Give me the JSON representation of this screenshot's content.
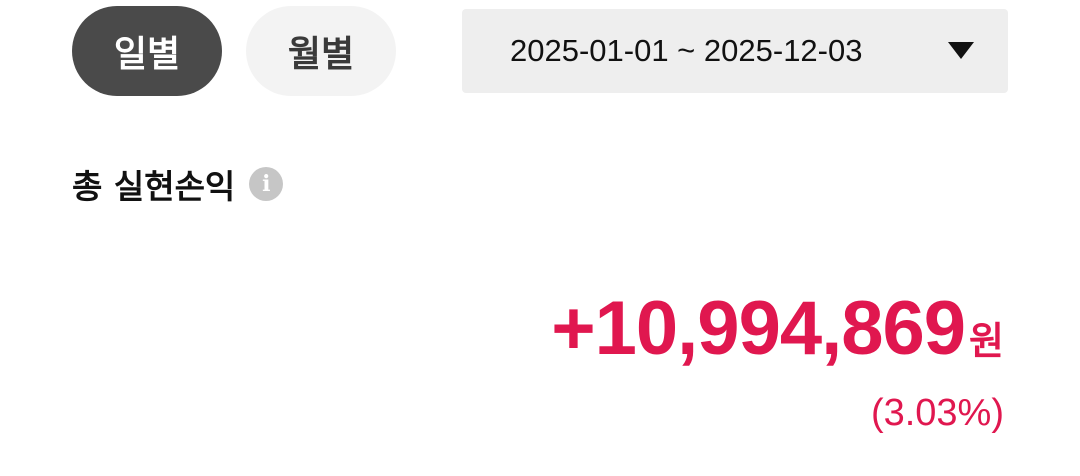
{
  "tabs": {
    "daily": "일별",
    "monthly": "월별"
  },
  "date_range": {
    "value": "2025-01-01 ~ 2025-12-03",
    "dropdown_icon": "caret-down-icon"
  },
  "summary": {
    "title": "총 실현손익",
    "info_icon": "info-icon",
    "info_glyph": "i",
    "amount": "+10,994,869",
    "currency": "원",
    "rate": "(3.03%)"
  },
  "colors": {
    "tab_active_bg": "#4a4a4a",
    "tab_inactive_bg": "#f3f3f3",
    "select_bg": "#eeeeee",
    "profit": "#e0174f",
    "info_icon": "#c6c6c6"
  }
}
